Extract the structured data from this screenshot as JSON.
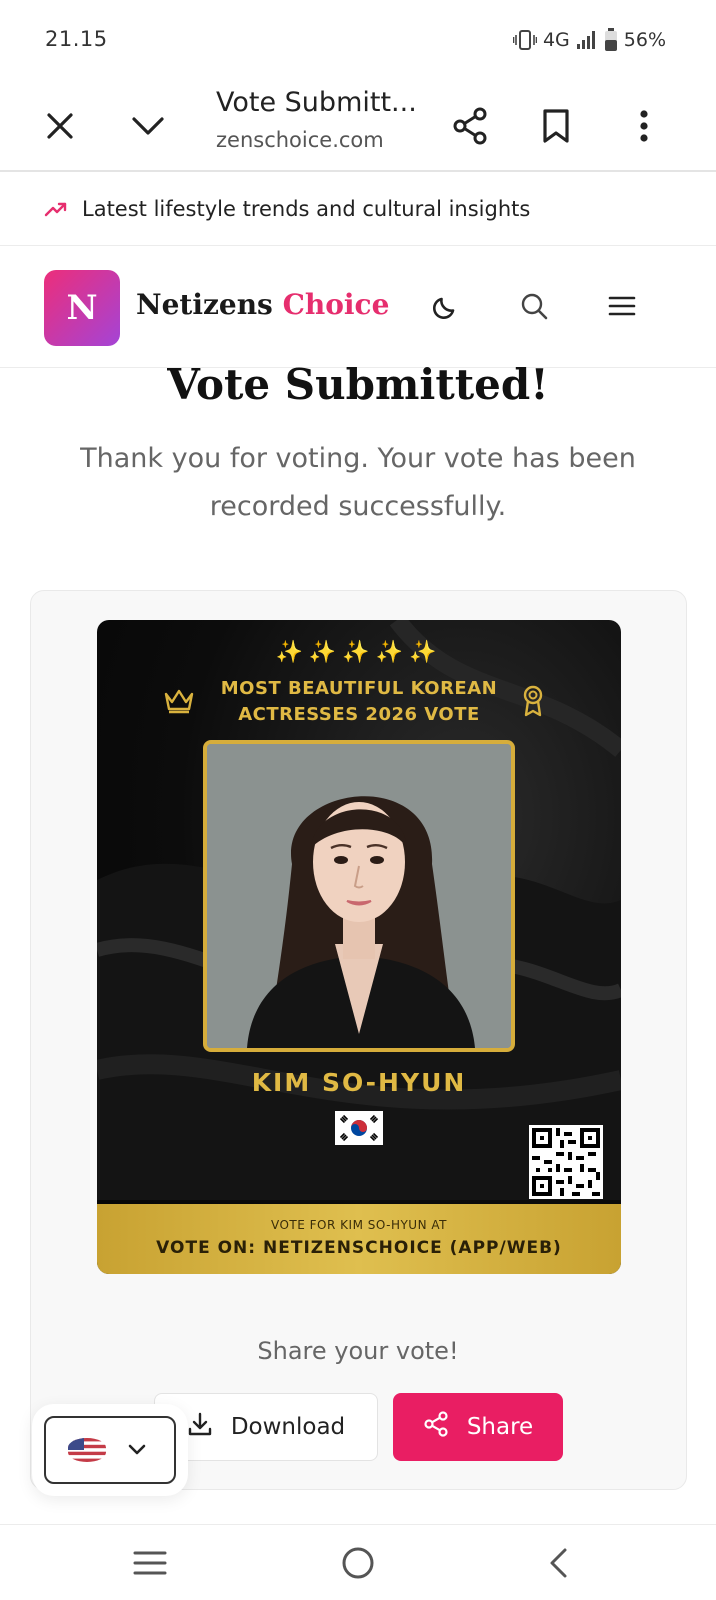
{
  "status_bar": {
    "time": "21.15",
    "network": "4G",
    "battery": "56%"
  },
  "browser": {
    "title": "Vote Submitt...",
    "url": "zenschoice.com",
    "icons": [
      "close-icon",
      "chevron-down-icon",
      "share-icon",
      "bookmark-icon",
      "more-vert-icon"
    ]
  },
  "trending": {
    "text": "Latest lifestyle trends and cultural insights",
    "icon": "trending-up-icon",
    "icon_color": "#e62e6e"
  },
  "site": {
    "logo_letter": "N",
    "name_part1": "Netizens",
    "name_part2": "Choice",
    "accent_color": "#e62e6e",
    "header_icons": [
      "moon-icon",
      "search-icon",
      "menu-icon"
    ]
  },
  "main": {
    "title": "Vote Submitted!",
    "message": "Thank you for voting. Your vote has been recorded successfully."
  },
  "vote_card": {
    "stars": "✨✨✨✨✨",
    "heading_line1": "MOST BEAUTIFUL KOREAN",
    "heading_line2": "ACTRESSES 2026 VOTE",
    "actress_name": "KIM SO-HYUN",
    "band_small": "VOTE FOR KIM SO-HYUN AT",
    "band_big": "VOTE ON: NETIZENSCHOICE (APP/WEB)",
    "gold_color": "#d6ad3b"
  },
  "share": {
    "caption": "Share your vote!",
    "download_label": "Download",
    "share_label": "Share",
    "share_color": "#e91e63"
  },
  "nav": {
    "icons": [
      "recents-icon",
      "home-icon",
      "back-icon"
    ]
  }
}
